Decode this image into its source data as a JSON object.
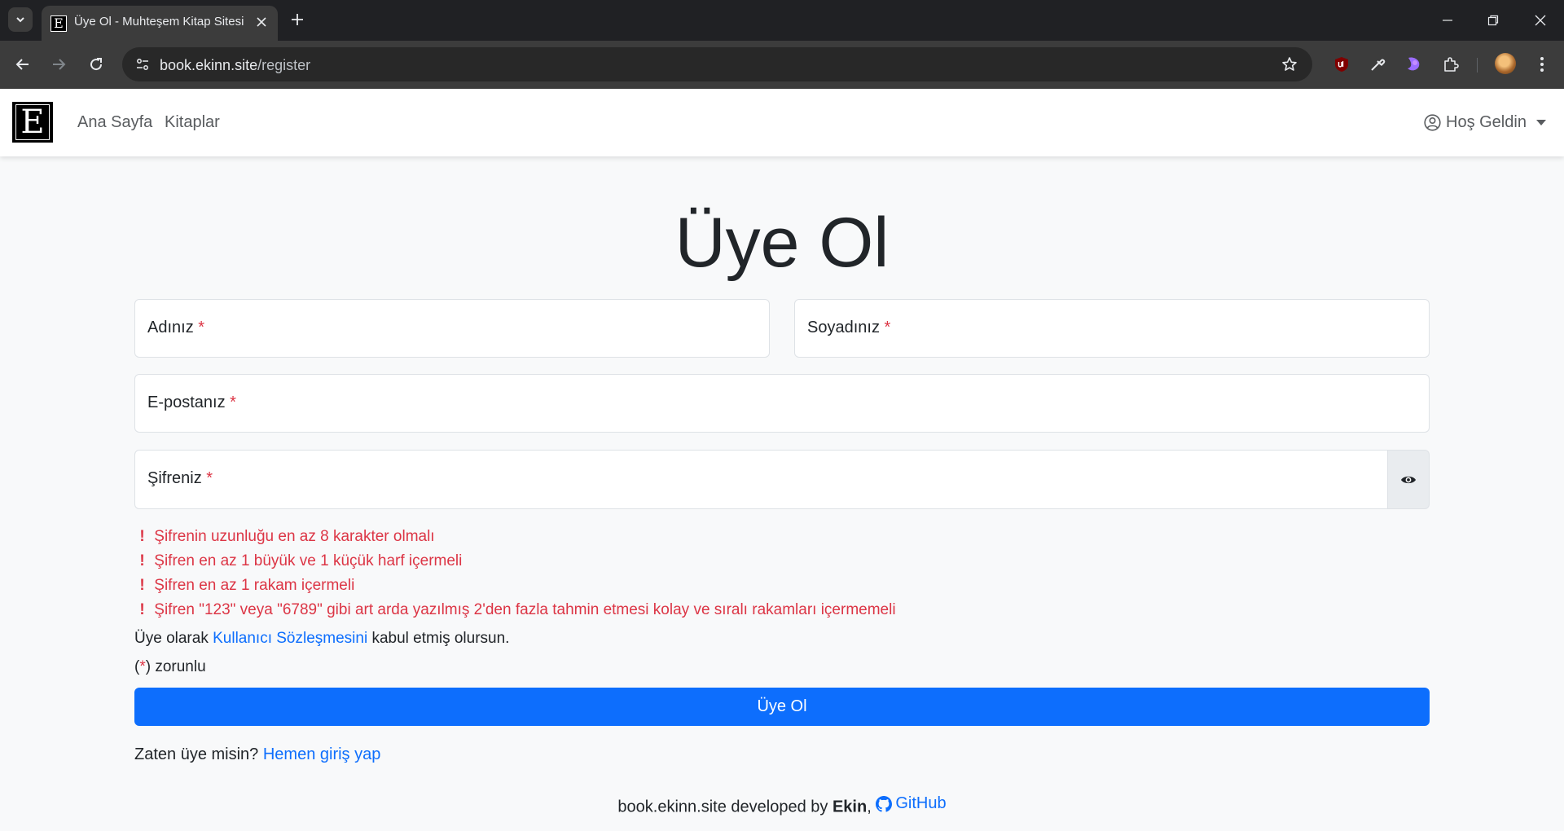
{
  "browser": {
    "tab_title": "Üye Ol - Muhteşem Kitap Sitesi",
    "url_host": "book.ekinn.site",
    "url_path": "/register",
    "favicon_letter": "E"
  },
  "navbar": {
    "brand_letter": "E",
    "links": [
      "Ana Sayfa",
      "Kitaplar"
    ],
    "user_menu": "Hoş Geldin"
  },
  "form": {
    "title": "Üye Ol",
    "first_name_label": "Adınız",
    "last_name_label": "Soyadınız",
    "email_label": "E-postanız",
    "password_label": "Şifreniz",
    "required_mark": "*",
    "password_rules": [
      "Şifrenin uzunluğu en az 8 karakter olmalı",
      "Şifren en az 1 büyük ve 1 küçük harf içermeli",
      "Şifren en az 1 rakam içermeli",
      "Şifren \"123\" veya \"6789\" gibi art arda yazılmış 2'den fazla tahmin etmesi kolay ve sıralı rakamları içermemeli"
    ],
    "rule_mark": "!",
    "terms_prefix": "Üye olarak",
    "terms_link": "Kullanıcı Sözleşmesini",
    "terms_suffix": "kabul etmiş olursun.",
    "required_note_open": "(",
    "required_note_close": ") zorunlu",
    "submit_label": "Üye Ol",
    "login_prompt": "Zaten üye misin?",
    "login_link": "Hemen giriş yap"
  },
  "footer": {
    "text": "book.ekinn.site developed by",
    "author": "Ekin",
    "separator": ",",
    "github_label": "GitHub"
  },
  "colors": {
    "primary": "#0d6efd",
    "danger": "#dc3545",
    "background": "#f8f9fa"
  }
}
